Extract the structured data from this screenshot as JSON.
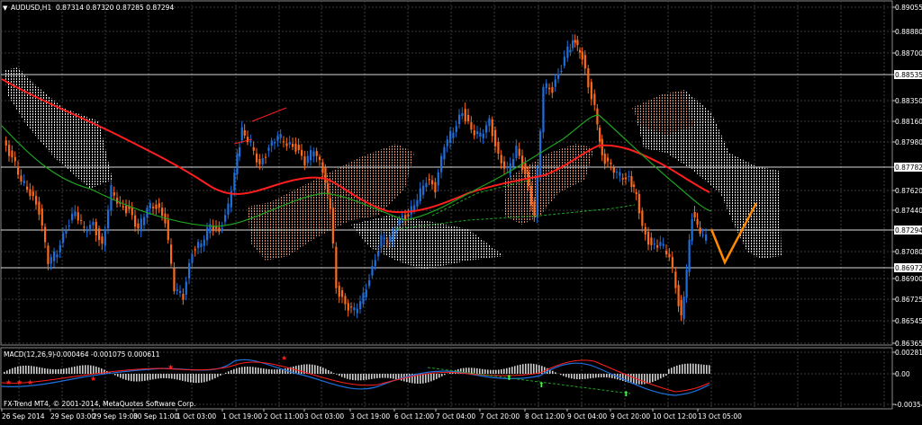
{
  "chart_header": {
    "symbol_tf": "AUDUSD,H1",
    "ohlc": "0.87314 0.87320 0.87285 0.87294"
  },
  "macd_header": {
    "label": "MACD(12,26,9)",
    "values": "-0.000464 -0.001075 0.000611"
  },
  "copyright": "FX-Trend MT4, © 2001-2014, MetaQuotes Software Corp.",
  "colors": {
    "background": "#000000",
    "grid": "#3a3a3a",
    "bull_candle": "#1e6fdc",
    "bear_candle": "#ff6a1a",
    "ma_red": "#ff1e1e",
    "ma_green": "#1fa31f",
    "cloud_light": "#ffffff",
    "cloud_dark": "#e8a070",
    "projection": "#ff8a00",
    "macd_main": "#1e6fdc",
    "macd_signal": "#ff1e1e",
    "macd_hist": "#cfcfcf"
  },
  "chart_data": {
    "type": "candlestick",
    "price_axis_ticks": [
      "0.89055",
      "0.88880",
      "0.88700",
      "0.88535",
      "0.88350",
      "0.88160",
      "0.87980",
      "0.87782",
      "0.87620",
      "0.87440",
      "0.87294",
      "0.87080",
      "0.86972",
      "0.86900",
      "0.86725",
      "0.86545",
      "0.86365"
    ],
    "marked_levels": [
      "0.88535",
      "0.87782",
      "0.87294",
      "0.86972"
    ],
    "ylim": [
      0.86365,
      0.89055
    ],
    "time_axis_ticks": [
      "26 Sep 2014",
      "29 Sep 03:00",
      "29 Sep 19:00",
      "30 Sep 11:00",
      "1 Oct 03:00",
      "1 Oct 19:00",
      "2 Oct 11:00",
      "3 Oct 03:00",
      "3 Oct 19:00",
      "6 Oct 12:00",
      "7 Oct 04:00",
      "7 Oct 20:00",
      "8 Oct 12:00",
      "9 Oct 04:00",
      "9 Oct 20:00",
      "10 Oct 12:00",
      "13 Oct 05:00"
    ],
    "macd_axis_ticks": [
      "0.002814",
      "0.00",
      "-0.003542"
    ],
    "macd_ylim": [
      -0.003542,
      0.002814
    ]
  }
}
